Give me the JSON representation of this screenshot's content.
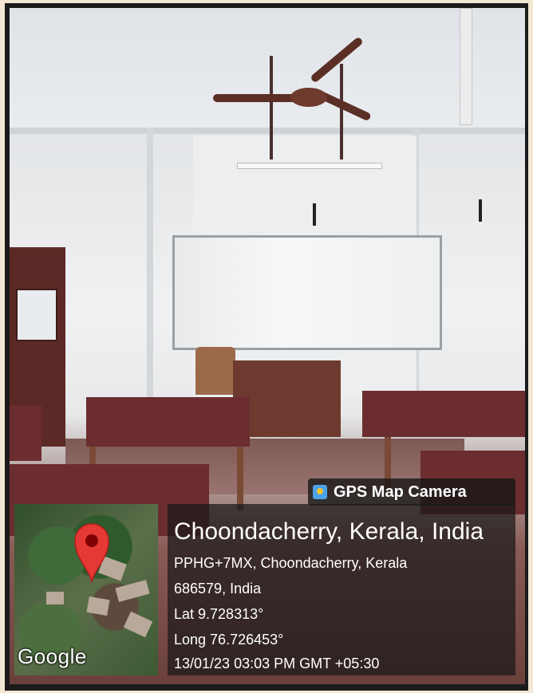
{
  "badge": {
    "icon": "gps-map-camera-icon",
    "label": "GPS Map Camera"
  },
  "location": {
    "title": "Choondacherry, Kerala, India",
    "address_line1": "PPHG+7MX, Choondacherry, Kerala",
    "address_line2": "686579, India",
    "lat": "Lat 9.728313°",
    "long": "Long 76.726453°",
    "datetime": "13/01/23 03:03 PM GMT +05:30"
  },
  "map": {
    "logo_text": "Google",
    "pin_icon": "map-pin-icon",
    "pin_color": "#e53935"
  }
}
